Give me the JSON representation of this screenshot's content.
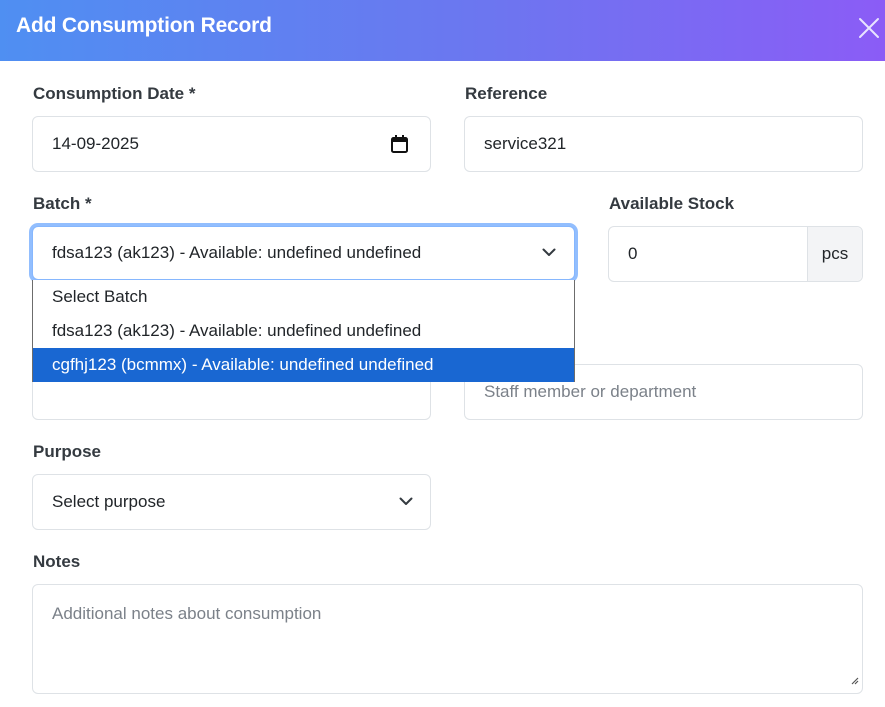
{
  "modal": {
    "title": "Add Consumption Record",
    "close_icon": "close-icon"
  },
  "form": {
    "consumption_date": {
      "label": "Consumption Date *",
      "value": "14-09-2025",
      "icon": "calendar-icon"
    },
    "reference": {
      "label": "Reference",
      "value": "service321"
    },
    "batch": {
      "label": "Batch *",
      "value": "fdsa123 (ak123) - Available: undefined undefined",
      "options": [
        "Select Batch",
        "fdsa123 (ak123) - Available: undefined undefined",
        "cgfhj123 (bcmmx) - Available: undefined undefined"
      ],
      "highlighted_index": 2
    },
    "available_stock": {
      "label": "Available Stock",
      "value": "0",
      "unit": "pcs"
    },
    "consumed_by": {
      "placeholder": "Staff member or department"
    },
    "purpose": {
      "label": "Purpose",
      "value": "Select purpose"
    },
    "notes": {
      "label": "Notes",
      "placeholder": "Additional notes about consumption"
    }
  },
  "colors": {
    "header_gradient_start": "#4f8ff2",
    "header_gradient_end": "#8b5cf6",
    "focus_ring": "#86b7fe",
    "option_highlight": "#1967d2"
  }
}
